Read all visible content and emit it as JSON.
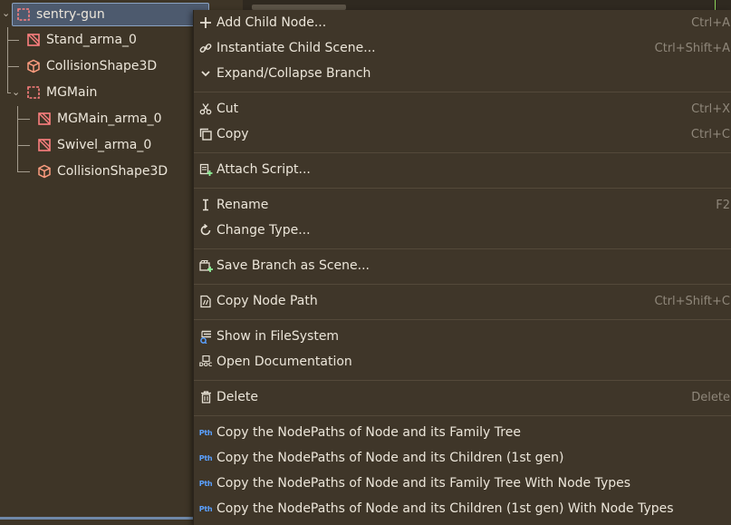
{
  "scene_tree": {
    "root": {
      "label": "sentry-gun",
      "icon": "node3d-icon"
    },
    "nodes": [
      {
        "label": "Stand_arma_0",
        "icon": "mesh-icon"
      },
      {
        "label": "CollisionShape3D",
        "icon": "collision-shape-icon"
      },
      {
        "label": "MGMain",
        "icon": "node3d-icon"
      },
      {
        "label": "MGMain_arma_0",
        "icon": "mesh-icon"
      },
      {
        "label": "Swivel_arma_0",
        "icon": "mesh-icon"
      },
      {
        "label": "CollisionShape3D",
        "icon": "collision-shape-icon"
      }
    ]
  },
  "context_menu": {
    "items": [
      {
        "label": "Add Child Node...",
        "shortcut": "Ctrl+A",
        "icon": "plus-icon"
      },
      {
        "label": "Instantiate Child Scene...",
        "shortcut": "Ctrl+Shift+A",
        "icon": "link-icon"
      },
      {
        "label": "Expand/Collapse Branch",
        "shortcut": "",
        "icon": "chevron-down-icon"
      },
      {
        "label": "Cut",
        "shortcut": "Ctrl+X",
        "icon": "scissors-icon"
      },
      {
        "label": "Copy",
        "shortcut": "Ctrl+C",
        "icon": "copy-icon"
      },
      {
        "label": "Attach Script...",
        "shortcut": "",
        "icon": "attach-script-icon"
      },
      {
        "label": "Rename",
        "shortcut": "F2",
        "icon": "rename-icon"
      },
      {
        "label": "Change Type...",
        "shortcut": "",
        "icon": "change-type-icon"
      },
      {
        "label": "Save Branch as Scene...",
        "shortcut": "",
        "icon": "save-branch-icon"
      },
      {
        "label": "Copy Node Path",
        "shortcut": "Ctrl+Shift+C",
        "icon": "copy-path-icon"
      },
      {
        "label": "Show in FileSystem",
        "shortcut": "",
        "icon": "filesystem-icon"
      },
      {
        "label": "Open Documentation",
        "shortcut": "",
        "icon": "doc-icon"
      },
      {
        "label": "Delete",
        "shortcut": "Delete",
        "icon": "trash-icon"
      },
      {
        "label": "Copy the NodePaths of Node and its Family Tree",
        "shortcut": "",
        "icon": "pth-icon"
      },
      {
        "label": "Copy the NodePaths of Node and its Children (1st gen)",
        "shortcut": "",
        "icon": "pth-icon"
      },
      {
        "label": "Copy the NodePaths of Node and its Family Tree With Node Types",
        "shortcut": "",
        "icon": "pth-icon"
      },
      {
        "label": "Copy the NodePaths of Node and its Children (1st gen) With Node Types",
        "shortcut": "",
        "icon": "pth-icon"
      }
    ],
    "pth_icon_text": "Pth",
    "doc_icon_text": "DOC"
  },
  "colors": {
    "background": "#3e3527",
    "menu_background": "#3f3629",
    "selection": "#4d5a6e",
    "node3d_icon": "#fc7f7f",
    "pth_icon": "#5aa0ff"
  }
}
